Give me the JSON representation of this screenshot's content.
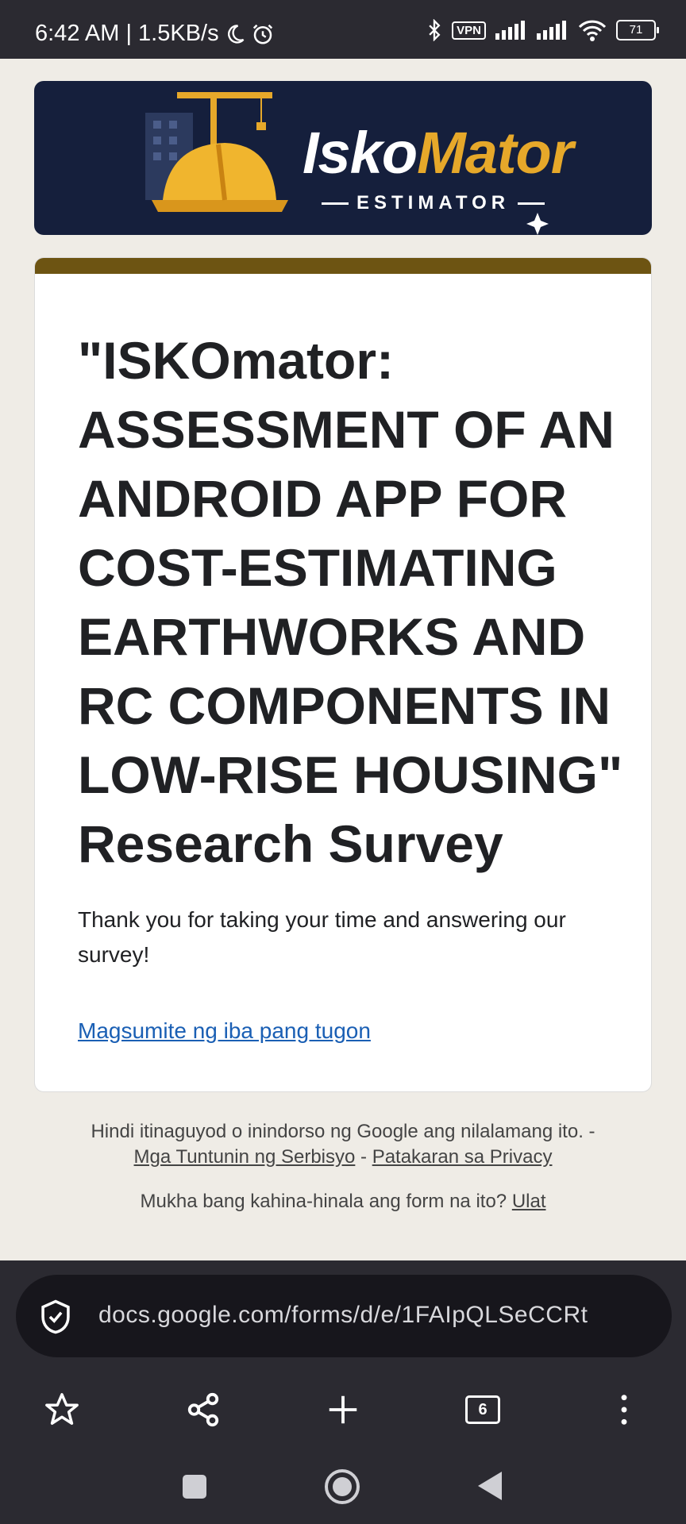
{
  "status_bar": {
    "time_speed": "6:42 AM | 1.5KB/s",
    "vpn_label": "VPN",
    "battery": "71"
  },
  "banner": {
    "title_part1": "Isko",
    "title_part2": "Mator",
    "subtitle": "ESTIMATOR",
    "accent_color": "#e6a82a",
    "background_color": "#151f3c"
  },
  "form": {
    "title": "\"ISKOmator: ASSESSMENT OF AN ANDROID APP FOR COST-ESTIMATING EARTHWORKS AND RC COMPONENTS IN LOW-RISE HOUSING\" Research Survey",
    "description": "Thank you for taking your time and answering our survey!",
    "submit_another_link": "Magsumite ng iba pang tugon",
    "header_color": "#6d5412"
  },
  "footer": {
    "disclaimer": "Hindi itinaguyod o inindorso ng Google ang nilalamang ito. -",
    "terms_link": "Mga Tuntunin ng Serbisyo",
    "separator": " - ",
    "privacy_link": "Patakaran sa Privacy",
    "suspicious_text": "Mukha bang kahina-hinala ang form na ito?",
    "report_link": "Ulat"
  },
  "browser": {
    "url": "docs.google.com/forms/d/e/1FAIpQLSeCCRt",
    "tab_count": "6"
  }
}
